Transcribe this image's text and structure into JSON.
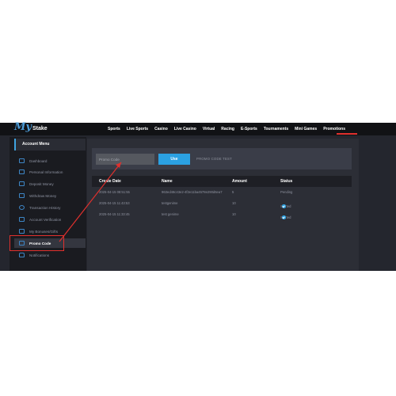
{
  "logo": {
    "my": "My",
    "stake": "Stake"
  },
  "nav": [
    "Sports",
    "Live Sports",
    "Casino",
    "Live Casino",
    "Virtual",
    "Racing",
    "E-Sports",
    "Tournaments",
    "Mini Games",
    "Promotions"
  ],
  "sidebar": {
    "header": "Account Menu",
    "items": [
      {
        "label": "Dashboard",
        "icon": "dashboard-icon"
      },
      {
        "label": "Personal Information",
        "icon": "id-card-icon"
      },
      {
        "label": "Deposit Money",
        "icon": "card-icon"
      },
      {
        "label": "Withdraw Money",
        "icon": "wallet-icon"
      },
      {
        "label": "Transaction History",
        "icon": "history-icon"
      },
      {
        "label": "Account Verification",
        "icon": "check-box-icon"
      },
      {
        "label": "My Bonuses/Gifts",
        "icon": "gift-icon"
      },
      {
        "label": "Promo Code",
        "icon": "ticket-icon",
        "active": true
      },
      {
        "label": "Notifications",
        "icon": "bell-icon"
      }
    ]
  },
  "promo": {
    "placeholder": "Promo Code",
    "use_label": "Use",
    "code_label": "PROMO CODE TEST"
  },
  "table": {
    "headers": [
      "Create Date",
      "Name",
      "Amount",
      "Status"
    ],
    "rows": [
      {
        "date": "2025-04-15 08:51:55",
        "name": "963ed48c43e2-4f2e11ba4578e290d6ea7",
        "amount": "5",
        "status": "Pending"
      },
      {
        "date": "2025-04-15 11:43:53",
        "name": "testgenime",
        "amount": "10",
        "status": "Started"
      },
      {
        "date": "2025-04-15 11:33:45",
        "name": "test genime",
        "amount": "10",
        "status": "Started"
      }
    ]
  },
  "colors": {
    "accent": "#2ba1e2",
    "highlight": "#e0302d",
    "background": "#24262e"
  }
}
